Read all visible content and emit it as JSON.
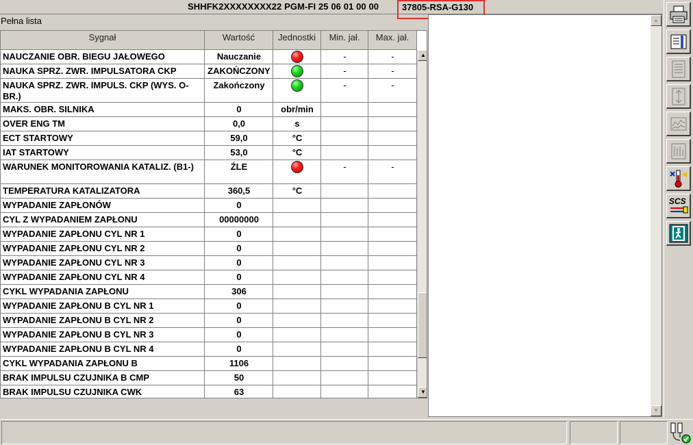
{
  "title": {
    "text": "SHHFK2XXXXXXXX22  PGM-FI  25 06 01 00 00",
    "part_number": "37805-RSA-G130"
  },
  "list_label": "Pełna lista",
  "columns": [
    "Sygnał",
    "Wartość",
    "Jednostki",
    "Min. jał.",
    "Max. jał."
  ],
  "rows": [
    {
      "signal": "NAUCZANIE OBR. BIEGU JAŁOWEGO",
      "value": "Nauczanie",
      "unit": "",
      "indicator": "red",
      "min": "-",
      "max": "-"
    },
    {
      "signal": "NAUKA SPRZ. ZWR. IMPULSATORA CKP",
      "value": "ZAKOŃCZONY",
      "unit": "",
      "indicator": "green",
      "min": "-",
      "max": "-"
    },
    {
      "signal": "NAUKA SPRZ. ZWR. IMPULS. CKP (WYS. O-BR.)",
      "value": "Zakończony",
      "unit": "",
      "indicator": "green",
      "min": "-",
      "max": "-"
    },
    {
      "signal": "MAKS. OBR. SILNIKA",
      "value": "0",
      "unit": "obr/min",
      "indicator": "",
      "min": "",
      "max": ""
    },
    {
      "signal": "OVER ENG TM",
      "value": "0,0",
      "unit": "s",
      "indicator": "",
      "min": "",
      "max": ""
    },
    {
      "signal": "ECT STARTOWY",
      "value": "59,0",
      "unit": "°C",
      "indicator": "",
      "min": "",
      "max": ""
    },
    {
      "signal": "IAT STARTOWY",
      "value": "53,0",
      "unit": "°C",
      "indicator": "",
      "min": "",
      "max": ""
    },
    {
      "signal": "WARUNEK MONITOROWANIA KATALIZ. (B1-)",
      "value": "ŹLE",
      "unit": "",
      "indicator": "red",
      "min": "-",
      "max": "-"
    },
    {
      "signal": "TEMPERATURA KATALIZATORA",
      "value": "360,5",
      "unit": "°C",
      "indicator": "",
      "min": "",
      "max": ""
    },
    {
      "signal": "WYPADANIE ZAPŁONÓW",
      "value": "0",
      "unit": "",
      "indicator": "",
      "min": "",
      "max": ""
    },
    {
      "signal": "CYL Z WYPADANIEM ZAPŁONU",
      "value": "00000000",
      "unit": "",
      "indicator": "",
      "min": "",
      "max": ""
    },
    {
      "signal": "WYPADANIE ZAPŁONU CYL NR 1",
      "value": "0",
      "unit": "",
      "indicator": "",
      "min": "",
      "max": ""
    },
    {
      "signal": "WYPADANIE ZAPŁONU CYL NR 2",
      "value": "0",
      "unit": "",
      "indicator": "",
      "min": "",
      "max": ""
    },
    {
      "signal": "WYPADANIE ZAPŁONU CYL NR 3",
      "value": "0",
      "unit": "",
      "indicator": "",
      "min": "",
      "max": ""
    },
    {
      "signal": "WYPADANIE ZAPŁONU CYL NR 4",
      "value": "0",
      "unit": "",
      "indicator": "",
      "min": "",
      "max": ""
    },
    {
      "signal": "CYKL WYPADANIA ZAPŁONU",
      "value": "306",
      "unit": "",
      "indicator": "",
      "min": "",
      "max": ""
    },
    {
      "signal": "WYPADANIE ZAPŁONU B CYL NR 1",
      "value": "0",
      "unit": "",
      "indicator": "",
      "min": "",
      "max": ""
    },
    {
      "signal": "WYPADANIE ZAPŁONU B CYL NR 2",
      "value": "0",
      "unit": "",
      "indicator": "",
      "min": "",
      "max": ""
    },
    {
      "signal": "WYPADANIE ZAPŁONU B CYL NR 3",
      "value": "0",
      "unit": "",
      "indicator": "",
      "min": "",
      "max": ""
    },
    {
      "signal": "WYPADANIE ZAPŁONU B CYL NR 4",
      "value": "0",
      "unit": "",
      "indicator": "",
      "min": "",
      "max": ""
    },
    {
      "signal": "CYKL WYPADANIA ZAPŁONU B",
      "value": "1106",
      "unit": "",
      "indicator": "",
      "min": "",
      "max": ""
    },
    {
      "signal": "BRAK IMPULSU CZUJNIKA B CMP",
      "value": "50",
      "unit": "",
      "indicator": "",
      "min": "",
      "max": ""
    },
    {
      "signal": "BRAK IMPULSU CZUJNIKA CWK",
      "value": "63",
      "unit": "",
      "indicator": "",
      "min": "",
      "max": ""
    }
  ],
  "toolbar": {
    "buttons": [
      "print-icon",
      "settings-icon",
      "list-icon",
      "split-view-icon",
      "graph-icon",
      "data-chart-icon",
      "thermometer-icon",
      "scs-icon",
      "exit-icon"
    ],
    "scs_label": "SCS"
  },
  "colors": {
    "indicator_red": "#ff2020",
    "indicator_green": "#20e020",
    "highlight_border": "#e03030",
    "exit_teal": "#008080"
  }
}
